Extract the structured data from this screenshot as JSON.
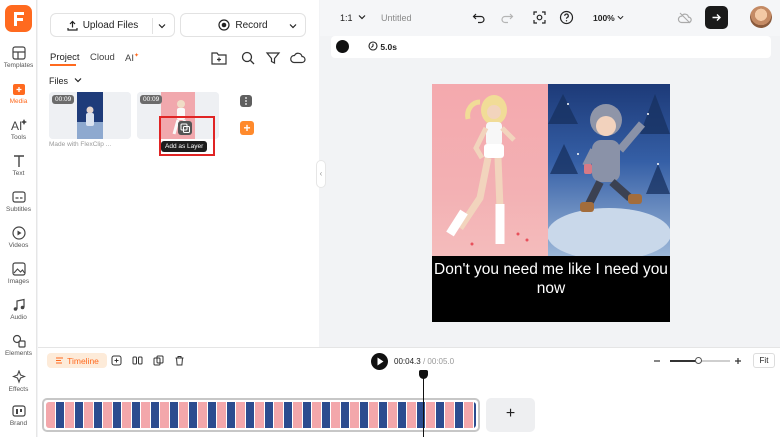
{
  "nav": {
    "items": [
      {
        "label": "Templates"
      },
      {
        "label": "Media"
      },
      {
        "label": "Tools"
      },
      {
        "label": "Text"
      },
      {
        "label": "Subtitles"
      },
      {
        "label": "Videos"
      },
      {
        "label": "Images"
      },
      {
        "label": "Audio"
      },
      {
        "label": "Elements"
      },
      {
        "label": "Effects"
      },
      {
        "label": "Brand"
      }
    ],
    "active": "Media",
    "accent": "#ff6a1f"
  },
  "panel": {
    "upload_label": "Upload Files",
    "record_label": "Record",
    "tabs": [
      {
        "label": "Project"
      },
      {
        "label": "Cloud"
      },
      {
        "label": "AI"
      }
    ],
    "files_label": "Files",
    "thumbs": [
      {
        "duration": "00:09"
      },
      {
        "duration": "00:09"
      }
    ],
    "made_with": "Made with FlexClip ...",
    "tooltip": "Add as Layer"
  },
  "topbar": {
    "ratio": "1:1",
    "project_name": "Untitled",
    "zoom": "100%"
  },
  "propbar": {
    "duration": "5.0s"
  },
  "canvas": {
    "caption": "Don't you need me like I need you now"
  },
  "timeline": {
    "label": "Timeline",
    "current_time": "00:04.3",
    "total_time": "00:05.0",
    "fit_label": "Fit"
  }
}
